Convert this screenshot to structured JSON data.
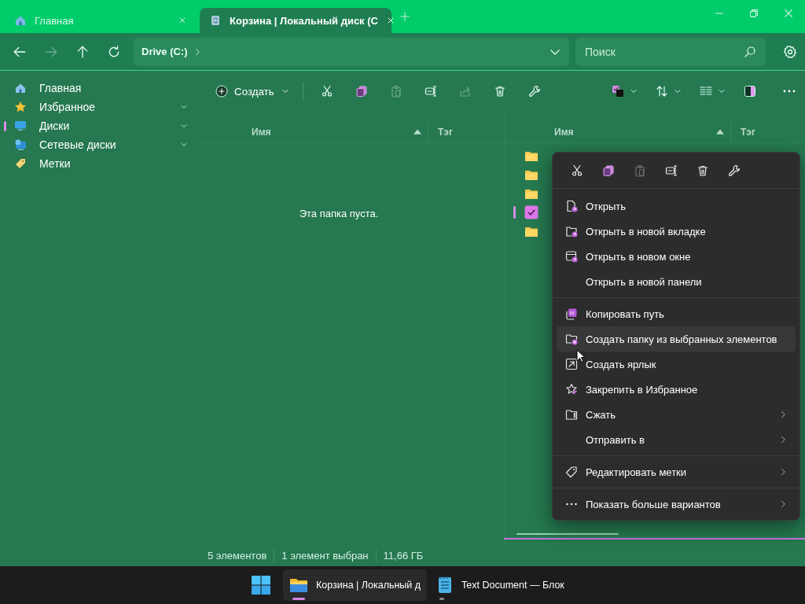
{
  "tabs": [
    {
      "label": "Главная",
      "selected": false
    },
    {
      "label": "Корзина | Локальный диск (C",
      "selected": true
    }
  ],
  "address": {
    "path": "Drive (C:)"
  },
  "search": {
    "placeholder": "Поиск"
  },
  "toolbar": {
    "create_label": "Создать",
    "tools": [
      {
        "disabled": false
      },
      {
        "disabled": false
      },
      {
        "disabled": true
      },
      {
        "disabled": false
      },
      {
        "disabled": true
      },
      {
        "disabled": false
      },
      {
        "disabled": false
      }
    ]
  },
  "sidebar": {
    "items": [
      {
        "label": "Главная",
        "expandable": false,
        "selected": false
      },
      {
        "label": "Избранное",
        "expandable": true,
        "selected": false
      },
      {
        "label": "Диски",
        "expandable": true,
        "selected": true
      },
      {
        "label": "Сетевые диски",
        "expandable": true,
        "selected": false
      },
      {
        "label": "Метки",
        "expandable": false,
        "selected": false
      }
    ]
  },
  "panes": [
    {
      "active": false,
      "columns": [
        "Имя",
        "Тэг"
      ],
      "empty_message": "Эта папка пуста."
    },
    {
      "active": true,
      "columns": [
        "Имя",
        "Тэг"
      ],
      "rows": [
        {
          "selected": false
        },
        {
          "selected": false
        },
        {
          "selected": false
        },
        {
          "selected": true
        },
        {
          "selected": false
        }
      ]
    }
  ],
  "context_menu": {
    "tools": [
      {
        "disabled": false
      },
      {
        "disabled": false
      },
      {
        "disabled": true
      },
      {
        "disabled": false
      },
      {
        "disabled": false
      },
      {
        "disabled": false
      }
    ],
    "groups": [
      [
        {
          "label": "Открыть",
          "submenu": false,
          "hovered": false
        },
        {
          "label": "Открыть в новой вкладке",
          "submenu": false,
          "hovered": false
        },
        {
          "label": "Открыть в новом окне",
          "submenu": false,
          "hovered": false
        },
        {
          "label": "Открыть в новой панели",
          "submenu": false,
          "hovered": false
        }
      ],
      [
        {
          "label": "Копировать путь",
          "submenu": false,
          "hovered": false
        },
        {
          "label": "Создать папку из выбранных элементов",
          "submenu": false,
          "hovered": true
        },
        {
          "label": "Создать ярлык",
          "submenu": false,
          "hovered": false
        },
        {
          "label": "Закрепить в Избранное",
          "submenu": false,
          "hovered": false
        },
        {
          "label": "Сжать",
          "submenu": true,
          "hovered": false
        },
        {
          "label": "Отправить в",
          "submenu": true,
          "hovered": false
        }
      ],
      [
        {
          "label": "Редактировать метки",
          "submenu": true,
          "hovered": false
        }
      ],
      [
        {
          "label": "Показать больше вариантов",
          "submenu": true,
          "hovered": false
        }
      ]
    ]
  },
  "status_bar": [
    "5 элементов",
    "1 элемент выбран",
    "11,66 ГБ"
  ],
  "taskbar": {
    "apps": [
      {
        "label": "Корзина | Локальный д",
        "active": true
      },
      {
        "label": "Text Document — Блок",
        "active": false
      }
    ]
  }
}
